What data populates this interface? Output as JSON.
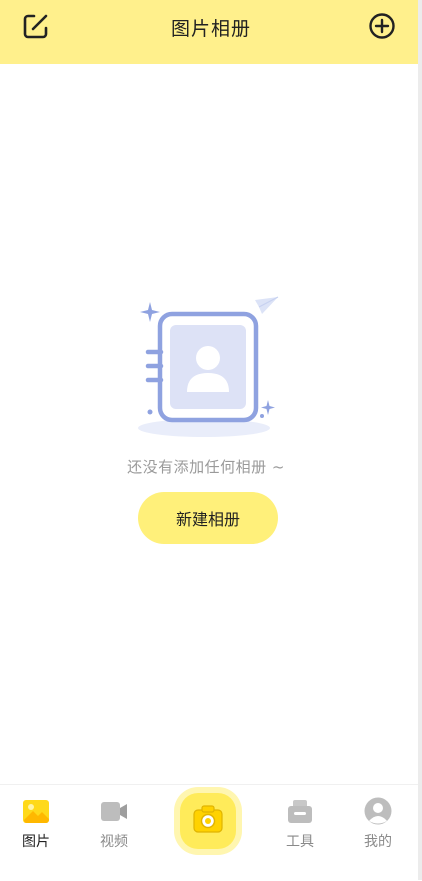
{
  "header": {
    "title": "图片相册",
    "left_icon": "edit-icon",
    "right_icon": "add-circle-icon"
  },
  "empty_state": {
    "illustration": "album-contact-illustration",
    "message": "还没有添加任何相册 ~",
    "button_label": "新建相册"
  },
  "tabbar": {
    "tabs": [
      {
        "label": "图片",
        "icon": "image-icon",
        "active": true
      },
      {
        "label": "视频",
        "icon": "video-icon",
        "active": false
      },
      {
        "label": "",
        "icon": "camera-icon",
        "active": false
      },
      {
        "label": "工具",
        "icon": "toolbox-icon",
        "active": false
      },
      {
        "label": "我的",
        "icon": "profile-icon",
        "active": false
      }
    ]
  },
  "colors": {
    "header_bg": "#FFF08C",
    "button_bg": "#FFF07A",
    "accent": "#FFD91A",
    "illustration": "#8FA2E0"
  }
}
